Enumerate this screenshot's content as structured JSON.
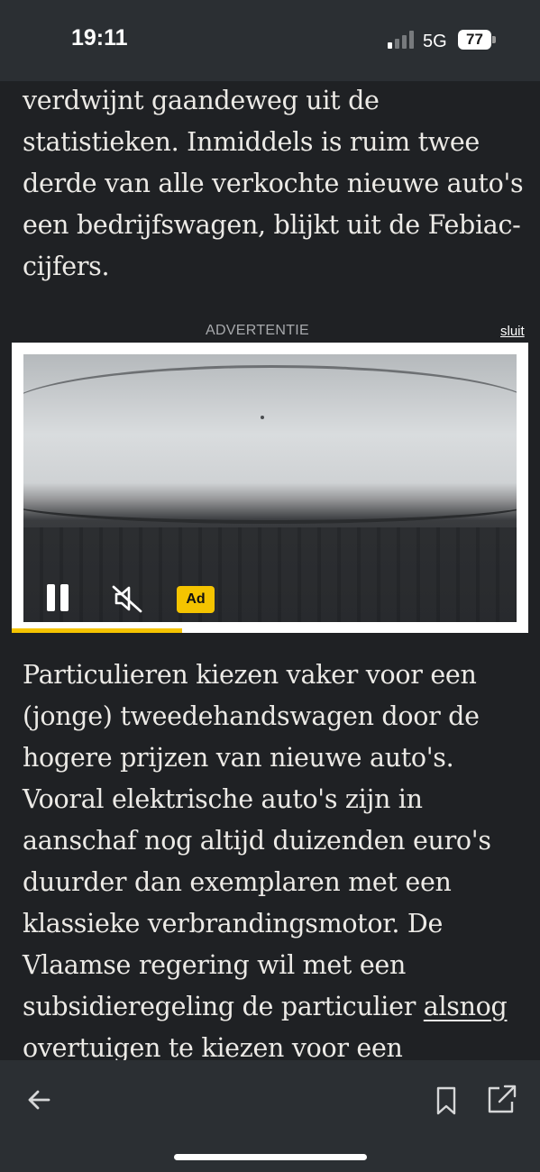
{
  "status_bar": {
    "time": "19:11",
    "network": "5G",
    "battery": "77",
    "signal_bars_active": 1,
    "signal_bars_total": 4
  },
  "article": {
    "paragraph_top": "verdwijnt gaandeweg uit de statistieken. Inmiddels is ruim twee derde van alle verkochte nieuwe auto's een bedrijfswagen, blijkt uit de Febiac-cijfers.",
    "paragraph_bottom_before_link": "Particulieren kiezen vaker voor een (jonge) tweedehandswagen door de hogere prijzen van nieuwe auto's. Vooral elektrische auto's zijn in aanschaf nog altijd duizenden euro's duurder dan exemplaren met een klassieke verbrandingsmotor. De Vlaamse regering wil met een subsidieregeling de particulier ",
    "link_text": "alsnog overtuigen",
    "paragraph_bottom_after_link": " te kiezen voor een elektrische auto bij"
  },
  "ad": {
    "label": "ADVERTENTIE",
    "close_label": "sluit",
    "badge": "Ad",
    "progress_fraction": 0.33,
    "icons": {
      "pause": "pause-icon",
      "mute": "muted-speaker-icon"
    },
    "accent_color": "#f5c400"
  },
  "toolbar": {
    "icons": [
      "back-arrow-icon",
      "bookmark-icon",
      "share-external-icon"
    ]
  },
  "colors": {
    "background": "#1f2124",
    "bars": "#2b2f33",
    "text": "#eceae6"
  }
}
